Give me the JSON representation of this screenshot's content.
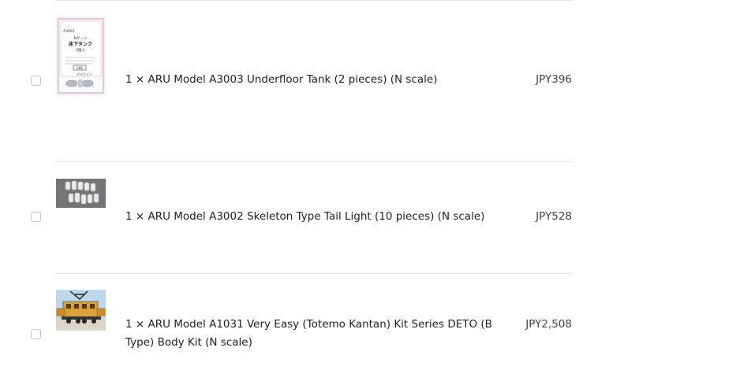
{
  "items": [
    {
      "title": "1 × ARU Model A3003 Underfloor Tank (2 pieces) (N scale)",
      "price": "JPY396",
      "thumb_icon": "product-package-icon",
      "package_text": {
        "code": "A3003",
        "line1": "Nゲージ",
        "line2": "床下タンク",
        "line3": "2個入",
        "price_tag": "300",
        "brand": "アルナイン"
      }
    },
    {
      "title": "1 × ARU Model A3002 Skeleton Type Tail Light (10 pieces) (N scale)",
      "price": "JPY528",
      "thumb_icon": "tail-light-parts-icon"
    },
    {
      "title": "1 × ARU Model A1031 Very Easy (Totemo Kantan) Kit Series DETO (B Type) Body Kit (N scale)",
      "price": "JPY2,508",
      "thumb_icon": "electric-locomotive-icon"
    }
  ],
  "colors": {
    "divider": "#e6e6e6",
    "checkbox_border": "#c4c4c4",
    "text": "#222222",
    "price": "#444444",
    "loco_body": "#d9a13a"
  }
}
